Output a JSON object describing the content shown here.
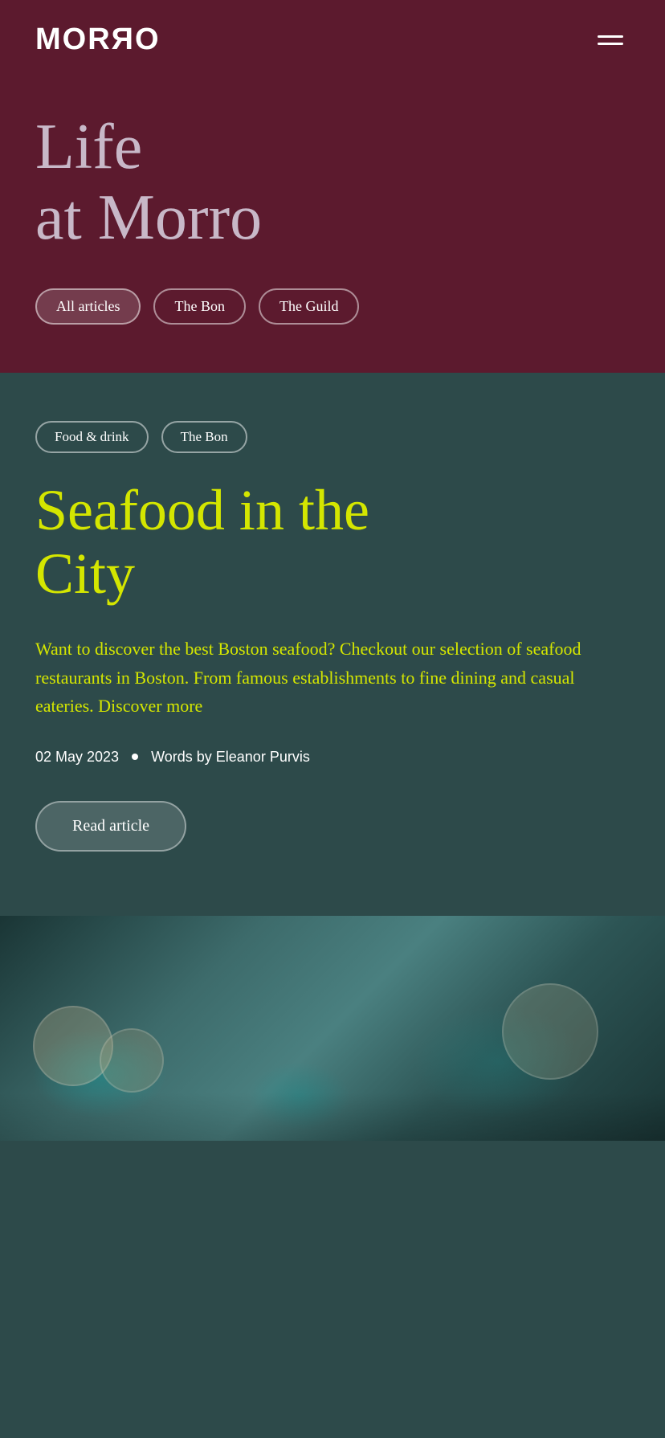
{
  "brand": {
    "logo": "MORЯO"
  },
  "hero": {
    "title_line1": "Life",
    "title_line2": "at Morro",
    "filters": [
      {
        "id": "all",
        "label": "All articles",
        "active": true
      },
      {
        "id": "bon",
        "label": "The Bon",
        "active": false
      },
      {
        "id": "guild",
        "label": "The Guild",
        "active": false
      }
    ]
  },
  "article": {
    "tags": [
      {
        "label": "Food & drink"
      },
      {
        "label": "The Bon"
      }
    ],
    "title_line1": "Seafood in the",
    "title_line2": "City",
    "excerpt": "Want to discover the best Boston seafood? Checkout our selection of seafood restaurants in Boston. From famous establishments to fine dining and casual eateries. Discover more",
    "date": "02 May 2023",
    "author": "Words by Eleanor Purvis",
    "read_button": "Read article"
  },
  "colors": {
    "hero_bg": "#5c1a2e",
    "article_bg": "#2d4a4a",
    "accent_yellow": "#d4e600",
    "text_white": "#ffffff",
    "text_muted": "#c8b8c8"
  }
}
